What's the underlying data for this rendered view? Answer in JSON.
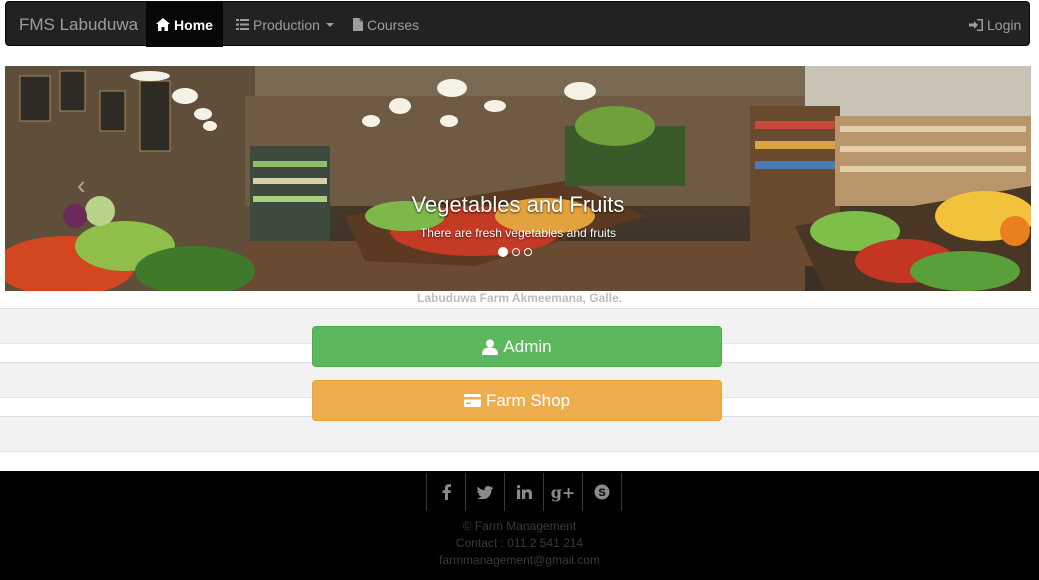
{
  "navbar": {
    "brand": "FMS Labuduwa",
    "items": [
      {
        "label": "Home",
        "icon": "home-icon",
        "active": true
      },
      {
        "label": "Production",
        "icon": "list-icon",
        "dropdown": true
      },
      {
        "label": "Courses",
        "icon": "file-icon"
      }
    ],
    "login_label": "Login"
  },
  "carousel": {
    "title": "Vegetables and Fruits",
    "subtitle": "There are fresh vegetables and fruits"
  },
  "location": "Labuduwa Farm Akmeemana, Galle.",
  "buttons": {
    "admin_label": "Admin",
    "shop_label": "Farm Shop",
    "admin_color": "#5cb85c",
    "shop_color": "#f0ad4e"
  },
  "footer": {
    "socials": [
      "facebook-icon",
      "twitter-icon",
      "linkedin-icon",
      "google-plus-icon",
      "skype-icon"
    ],
    "copyright": "© Farm Management",
    "contact": "Contact : 011 2 541 214",
    "email": "farmmanagement@gmail.com"
  }
}
